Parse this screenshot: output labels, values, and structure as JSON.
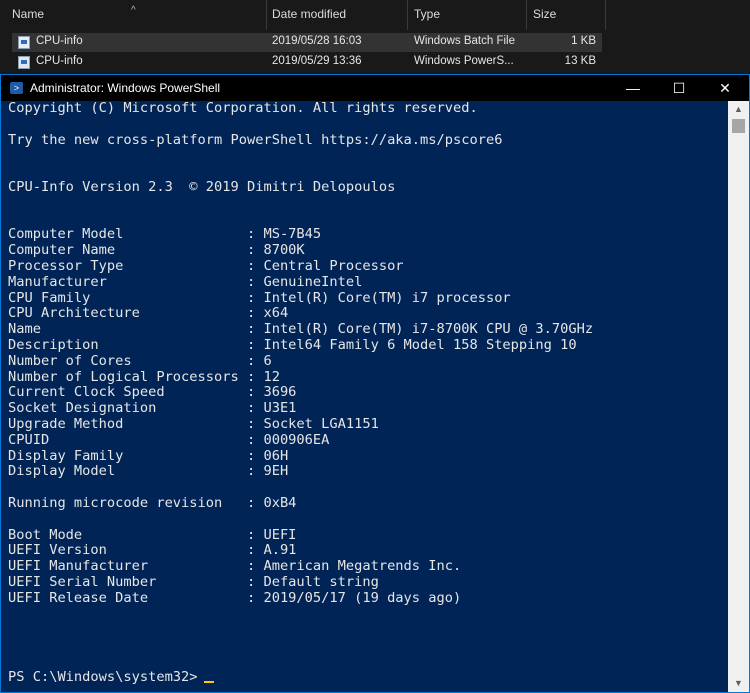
{
  "explorer": {
    "columns": [
      "Name",
      "Date modified",
      "Type",
      "Size"
    ],
    "rows": [
      {
        "name": "CPU-info",
        "date": "2019/05/28 16:03",
        "type": "Windows Batch File",
        "size": "1 KB"
      },
      {
        "name": "CPU-info",
        "date": "2019/05/29 13:36",
        "type": "Windows PowerS...",
        "size": "13 KB"
      }
    ]
  },
  "window": {
    "title": "Administrator: Windows PowerShell",
    "buttons": {
      "minimize": "—",
      "maximize": "☐",
      "close": "✕"
    }
  },
  "console": {
    "lines": [
      "Copyright (C) Microsoft Corporation. All rights reserved.",
      "",
      "Try the new cross-platform PowerShell https://aka.ms/pscore6",
      "",
      "",
      "CPU-Info Version 2.3  © 2019 Dimitri Delopoulos",
      "",
      "",
      "Computer Model               : MS-7B45",
      "Computer Name                : 8700K",
      "Processor Type               : Central Processor",
      "Manufacturer                 : GenuineIntel",
      "CPU Family                   : Intel(R) Core(TM) i7 processor",
      "CPU Architecture             : x64",
      "Name                         : Intel(R) Core(TM) i7-8700K CPU @ 3.70GHz",
      "Description                  : Intel64 Family 6 Model 158 Stepping 10",
      "Number of Cores              : 6",
      "Number of Logical Processors : 12",
      "Current Clock Speed          : 3696",
      "Socket Designation           : U3E1",
      "Upgrade Method               : Socket LGA1151",
      "CPUID                        : 000906EA",
      "Display Family               : 06H",
      "Display Model                : 9EH",
      "",
      "Running microcode revision   : 0xB4",
      "",
      "Boot Mode                    : UEFI",
      "UEFI Version                 : A.91",
      "UEFI Manufacturer            : American Megatrends Inc.",
      "UEFI Serial Number           : Default string",
      "UEFI Release Date            : 2019/05/17 (19 days ago)",
      "",
      "",
      "",
      ""
    ],
    "prompt": "PS C:\\Windows\\system32>"
  },
  "colors": {
    "console_bg": "#012456",
    "cursor": "#ffc700",
    "window_border": "#0078d7"
  }
}
